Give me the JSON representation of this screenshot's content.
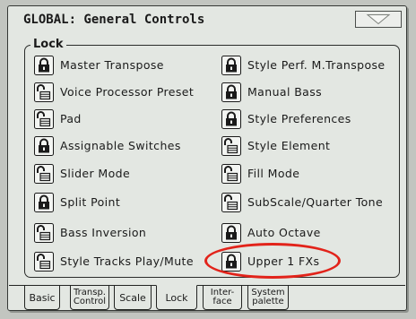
{
  "header": {
    "title": "GLOBAL: General Controls",
    "menu_icon": "dropdown-arrow-icon"
  },
  "lock_group": {
    "label": "Lock",
    "left": [
      {
        "label": "Master Transpose",
        "locked": true,
        "icon": "lock-closed-icon"
      },
      {
        "label": "Voice Processor Preset",
        "locked": false,
        "icon": "lock-open-icon"
      },
      {
        "label": "Pad",
        "locked": false,
        "icon": "lock-open-icon"
      },
      {
        "label": "Assignable Switches",
        "locked": true,
        "icon": "lock-closed-icon"
      },
      {
        "label": "Slider Mode",
        "locked": false,
        "icon": "lock-open-icon"
      },
      {
        "label": "Split Point",
        "locked": true,
        "icon": "lock-closed-icon"
      },
      {
        "label": "Bass Inversion",
        "locked": false,
        "icon": "lock-open-icon"
      },
      {
        "label": "Style Tracks Play/Mute",
        "locked": false,
        "icon": "lock-open-icon"
      }
    ],
    "right": [
      {
        "label": "Style Perf. M.Transpose",
        "locked": true,
        "icon": "lock-closed-icon"
      },
      {
        "label": "Manual Bass",
        "locked": true,
        "icon": "lock-closed-icon"
      },
      {
        "label": "Style Preferences",
        "locked": true,
        "icon": "lock-closed-icon"
      },
      {
        "label": "Style Element",
        "locked": false,
        "icon": "lock-open-icon"
      },
      {
        "label": "Fill Mode",
        "locked": false,
        "icon": "lock-open-icon"
      },
      {
        "label": "SubScale/Quarter Tone",
        "locked": false,
        "icon": "lock-open-icon"
      },
      {
        "label": "Auto Octave",
        "locked": true,
        "icon": "lock-closed-icon"
      },
      {
        "label": "Upper 1 FXs",
        "locked": true,
        "icon": "lock-closed-icon"
      }
    ]
  },
  "tabs": [
    {
      "lines": [
        "Basic"
      ],
      "selected": false
    },
    {
      "lines": [
        "Transp.",
        "Control"
      ],
      "selected": false
    },
    {
      "lines": [
        "Scale"
      ],
      "selected": false
    },
    {
      "lines": [
        "Lock"
      ],
      "selected": true
    },
    {
      "lines": [
        "Inter-",
        "face"
      ],
      "selected": false
    },
    {
      "lines": [
        "System",
        "palette"
      ],
      "selected": false
    }
  ],
  "colors": {
    "screen": "#e3e7e2",
    "ink": "#1a1a1a",
    "highlight": "#e2231a"
  }
}
